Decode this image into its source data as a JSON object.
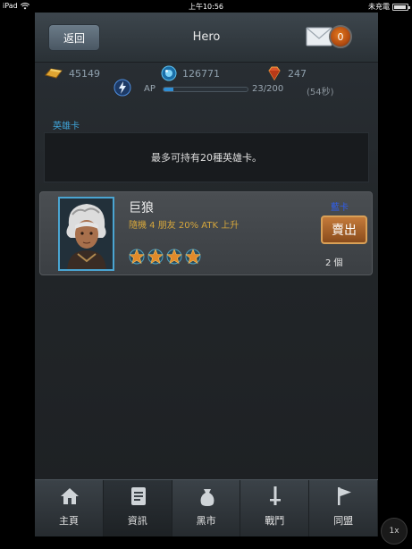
{
  "status_bar": {
    "device": "iPad",
    "time": "上午10:56",
    "charge_status": "未充電"
  },
  "header": {
    "back_label": "返回",
    "title": "Hero",
    "mail_badge": "0"
  },
  "resources": {
    "gold": "45149",
    "crystal": "126771",
    "gem": "247",
    "ap_label": "AP",
    "ap_value": "23/200",
    "ap_fraction": 0.115,
    "ap_timer": "(54秒)"
  },
  "section": {
    "label": "英雄卡",
    "notice": "最多可持有20種英雄卡。"
  },
  "hero_card": {
    "name": "巨狼",
    "description": "隨機 4 朋友 20% ATK 上升",
    "card_type": "藍卡",
    "card_type_color": "#2f5ff0",
    "sell_label": "賣出",
    "count": "2 個",
    "stars": 4
  },
  "tabs": [
    {
      "label": "主頁",
      "icon": "home-icon"
    },
    {
      "label": "資訊",
      "icon": "document-icon"
    },
    {
      "label": "黑市",
      "icon": "bag-icon"
    },
    {
      "label": "戰鬥",
      "icon": "sword-icon"
    },
    {
      "label": "同盟",
      "icon": "flag-icon"
    }
  ],
  "zoom": {
    "label": "1x"
  }
}
